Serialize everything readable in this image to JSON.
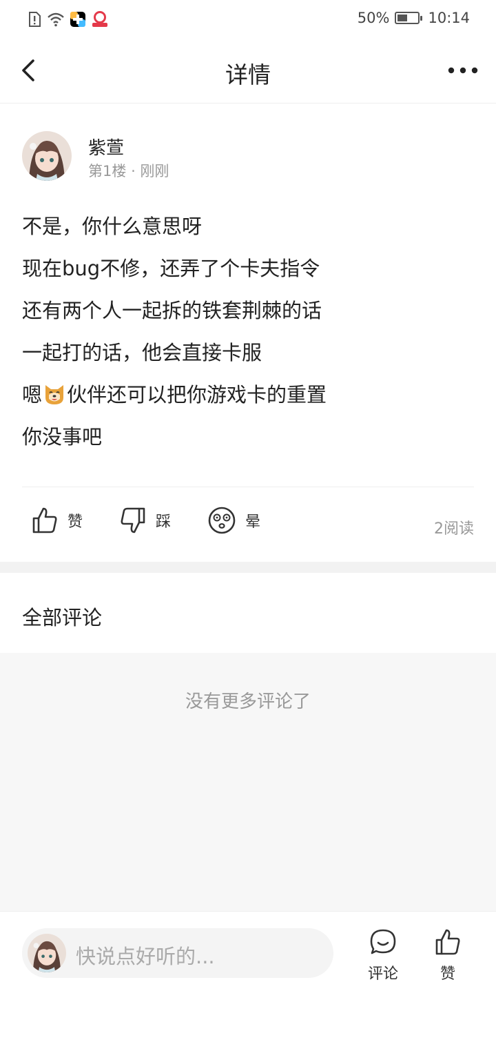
{
  "status_bar": {
    "battery": "50%",
    "time": "10:14",
    "battery_level": 0.5
  },
  "nav": {
    "title": "详情"
  },
  "post": {
    "author": "紫萱",
    "floor": "第1楼",
    "time": "刚刚",
    "lines": [
      "不是，你什么意思呀",
      "现在bug不修，还弄了个卡夫指令",
      "还有两个人一起拆的铁套荆棘的话",
      "一起打的话，他会直接卡服"
    ],
    "emoji_line_prefix": "嗯",
    "emoji_line_suffix": "伙伴还可以把你游戏卡的重置",
    "last_line": "你没事吧",
    "actions": {
      "like": "赞",
      "dislike": "踩",
      "dizzy": "晕"
    },
    "reads": "2阅读"
  },
  "comments": {
    "title": "全部评论",
    "empty_text": "没有更多评论了"
  },
  "bottom_bar": {
    "placeholder": "快说点好听的...",
    "comment_label": "评论",
    "like_label": "赞"
  }
}
